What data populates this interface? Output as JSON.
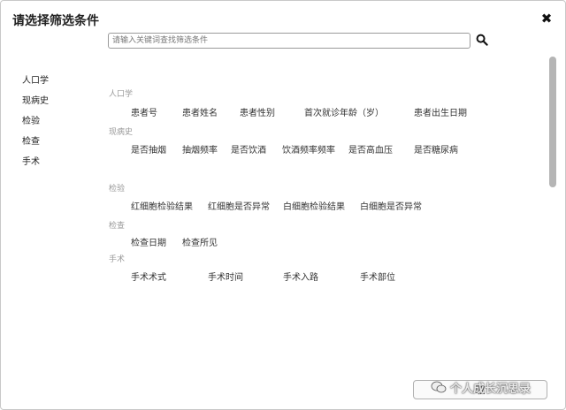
{
  "dialog": {
    "title": "请选择筛选条件",
    "close_label": "✖"
  },
  "search": {
    "placeholder": "请输入关键词查找筛选条件"
  },
  "sidebar": {
    "items": [
      {
        "label": "人口学"
      },
      {
        "label": "现病史"
      },
      {
        "label": "检验"
      },
      {
        "label": "检查"
      },
      {
        "label": "手术"
      }
    ]
  },
  "sections": [
    {
      "label": "人口学",
      "options": [
        "患者号",
        "患者姓名",
        "患者性别",
        "首次就诊年龄（岁）",
        "患者出生日期"
      ]
    },
    {
      "label": "现病史",
      "options": [
        "是否抽烟",
        "抽烟频率",
        "是否饮酒",
        "饮酒频率频率",
        "是否高血压",
        "是否糖尿病"
      ]
    },
    {
      "label": "检验",
      "options": [
        "红细胞检验结果",
        "红细胞是否异常",
        "白细胞检验结果",
        "白细胞是否异常"
      ]
    },
    {
      "label": "检查",
      "options": [
        "检查日期",
        "检查所见"
      ]
    },
    {
      "label": "手术",
      "options": [
        "手术术式",
        "手术时间",
        "手术入路",
        "手术部位"
      ]
    }
  ],
  "footer": {
    "button_label": "取"
  },
  "watermark": {
    "text": "个人成长沉思录"
  },
  "colors": {
    "category_gray": "#9a9a9a",
    "text": "#333333",
    "scroll_thumb": "#b5b5b5"
  }
}
